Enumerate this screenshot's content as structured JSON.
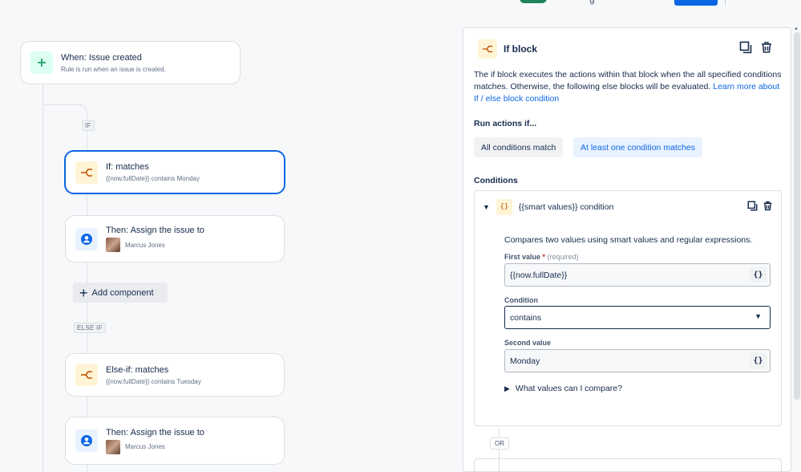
{
  "top": {
    "toggle_text": "g"
  },
  "flow": {
    "trigger": {
      "title": "When: Issue created",
      "subtitle": "Rule is run when an issue is created."
    },
    "if_tag": "IF",
    "if_card": {
      "title": "If: matches",
      "subtitle": "{{now.fullDate}} contains Monday"
    },
    "then1": {
      "title": "Then: Assign the issue to",
      "user": "Marcus Jones"
    },
    "add_component": "Add component",
    "else_if_tag": "ELSE IF",
    "elseif_card": {
      "title": "Else-if: matches",
      "subtitle": "{{now.fullDate}} contains Tuesday"
    },
    "then2": {
      "title": "Then: Assign the issue to",
      "user": "Marcus Jones"
    }
  },
  "panel": {
    "title": "If block",
    "description": "The if block executes the actions within that block when the all specified conditions matches. Otherwise, the following else blocks will be evaluated.",
    "learn_more": "Learn more about If / else block condition",
    "run_label": "Run actions if...",
    "option_all": "All conditions match",
    "option_any": "At least one condition matches",
    "conditions_label": "Conditions",
    "condition": {
      "title": "{{smart values}} condition",
      "icon_text": "{}",
      "description": "Compares two values using smart values and regular expressions.",
      "first_label": "First value",
      "required_mark": "*",
      "required_hint": "(required)",
      "first_value": "{{now.fullDate}}",
      "sv_button": "{}",
      "condition_label": "Condition",
      "condition_value": "contains",
      "second_label": "Second value",
      "second_value": "Monday",
      "help_link": "What values can I compare?"
    },
    "or_tag": "OR"
  },
  "colors": {
    "accent": "#0c66e4",
    "success": "#1f845a",
    "condition_icon": "#c25100",
    "trigger_icon": "#22a06b"
  }
}
